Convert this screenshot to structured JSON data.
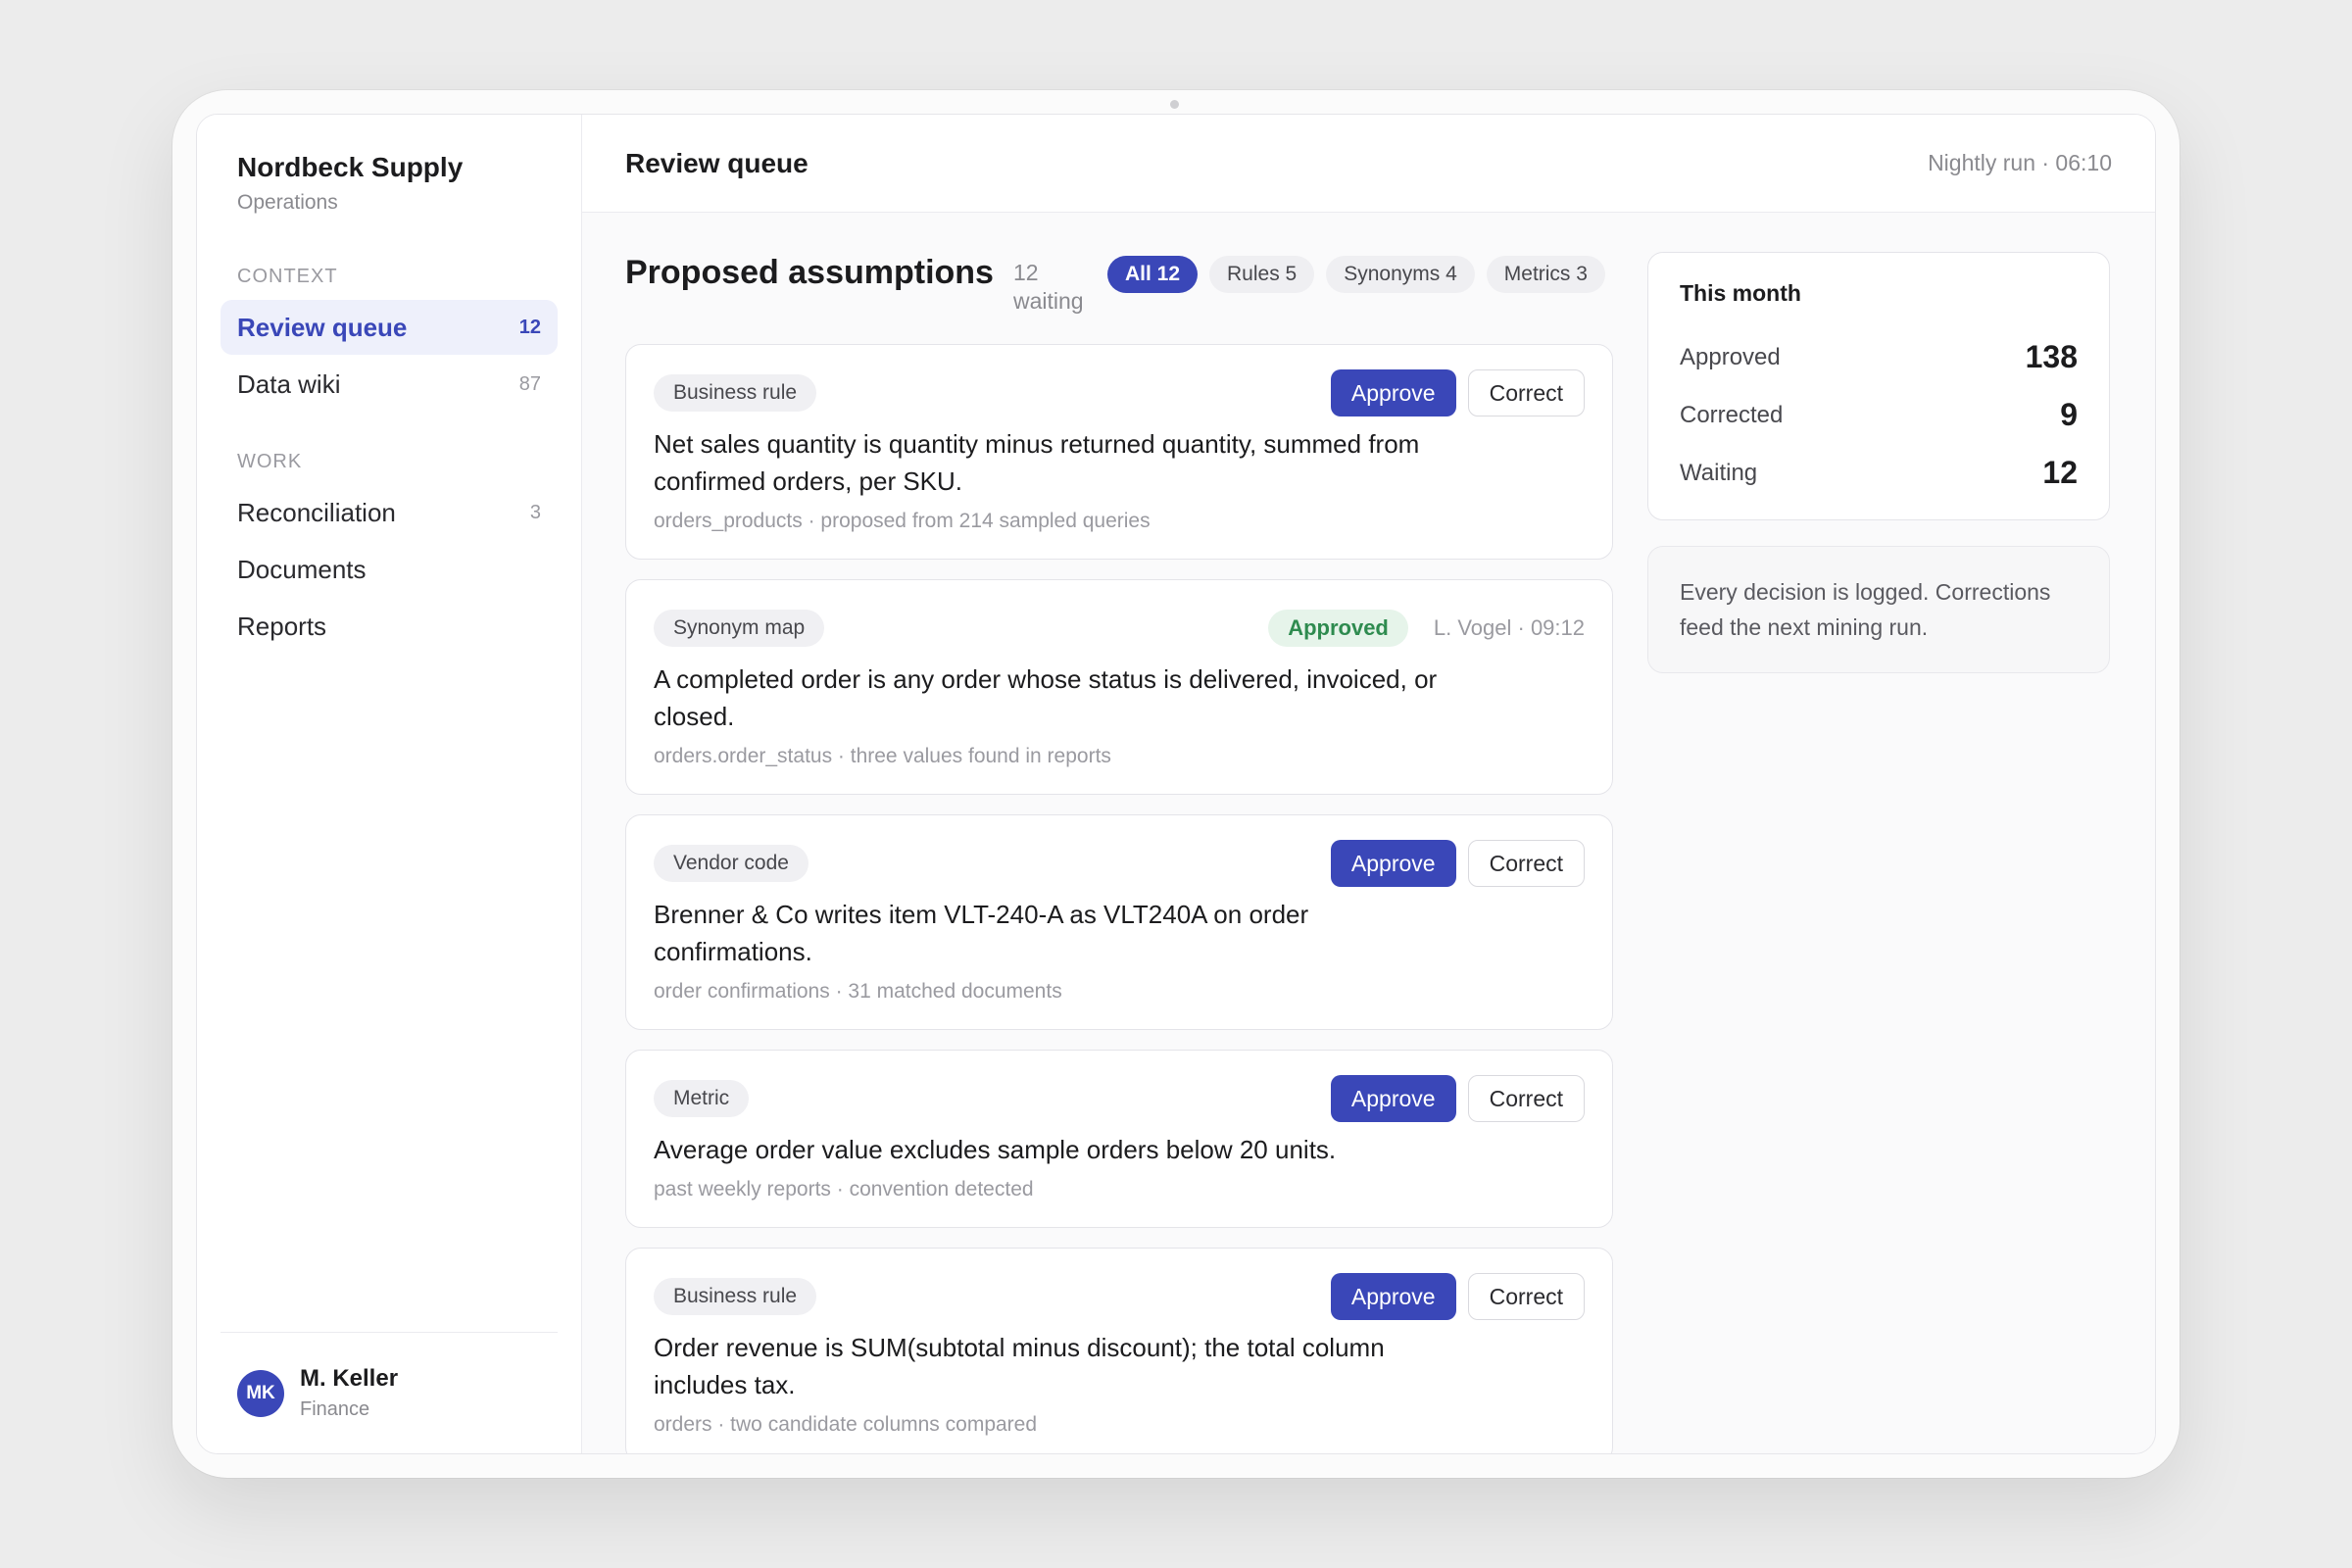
{
  "brand": {
    "name": "Nordbeck Supply",
    "subtitle": "Operations"
  },
  "sidebar": {
    "sections": [
      {
        "label": "CONTEXT",
        "items": [
          {
            "label": "Review queue",
            "count": "12",
            "active": true
          },
          {
            "label": "Data wiki",
            "count": "87"
          }
        ]
      },
      {
        "label": "WORK",
        "items": [
          {
            "label": "Reconciliation",
            "count": "3"
          },
          {
            "label": "Documents",
            "count": ""
          },
          {
            "label": "Reports",
            "count": ""
          }
        ]
      }
    ]
  },
  "user": {
    "initials": "MK",
    "name": "M. Keller",
    "role": "Finance"
  },
  "topbar": {
    "title": "Review queue",
    "meta": "Nightly run · 06:10"
  },
  "queue": {
    "heading": "Proposed assumptions",
    "waiting": "12 waiting",
    "filters": [
      {
        "label": "All 12",
        "active": true
      },
      {
        "label": "Rules 5"
      },
      {
        "label": "Synonyms 4"
      },
      {
        "label": "Metrics 3"
      }
    ],
    "approve_label": "Approve",
    "correct_label": "Correct",
    "cards": [
      {
        "tag": "Business rule",
        "status": "pending",
        "text": "Net sales quantity is quantity minus returned quantity, summed from confirmed orders, per SKU.",
        "meta": "orders_products · proposed from 214 sampled queries"
      },
      {
        "tag": "Synonym map",
        "status": "approved",
        "badge": "Approved",
        "by": "L. Vogel · 09:12",
        "text": "A completed order is any order whose status is delivered, invoiced, or closed.",
        "meta": "orders.order_status · three values found in reports"
      },
      {
        "tag": "Vendor code",
        "status": "pending",
        "text": "Brenner & Co writes item VLT-240-A as VLT240A on order confirmations.",
        "meta": "order confirmations · 31 matched documents"
      },
      {
        "tag": "Metric",
        "status": "pending",
        "text": "Average order value excludes sample orders below 20 units.",
        "meta": "past weekly reports · convention detected"
      },
      {
        "tag": "Business rule",
        "status": "pending",
        "text": "Order revenue is SUM(subtotal minus discount); the total column includes tax.",
        "meta": "orders · two candidate columns compared"
      }
    ]
  },
  "stats": {
    "title": "This month",
    "rows": [
      {
        "label": "Approved",
        "value": "138"
      },
      {
        "label": "Corrected",
        "value": "9"
      },
      {
        "label": "Waiting",
        "value": "12"
      }
    ]
  },
  "note": "Every decision is logged. Corrections feed the next mining run."
}
